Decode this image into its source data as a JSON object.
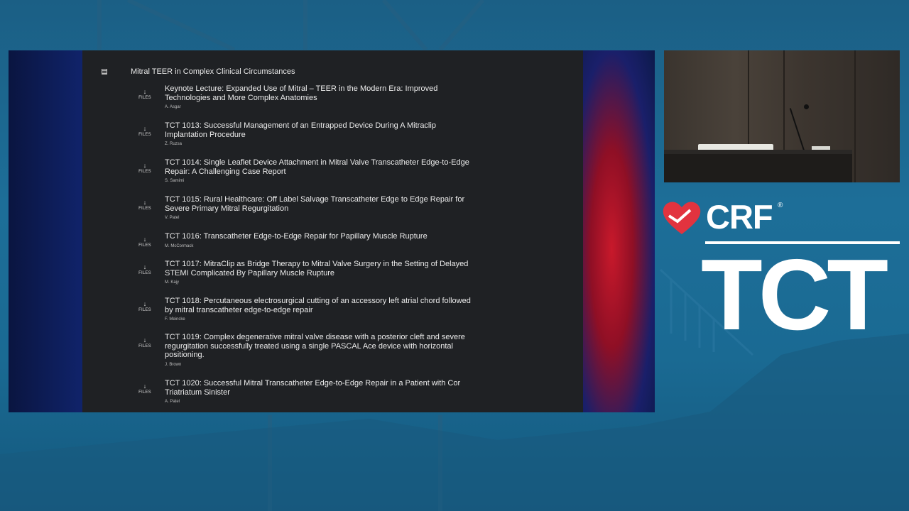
{
  "section": {
    "title": "Mitral TEER in Complex Clinical Circumstances"
  },
  "files_label": "FILES",
  "items": [
    {
      "title": "Keynote Lecture: Expanded Use of Mitral – TEER in the Modern Era: Improved Technologies and More Complex Anatomies",
      "author": "A. Asgar"
    },
    {
      "title": "TCT 1013: Successful Management of an Entrapped Device During A Mitraclip Implantation Procedure",
      "author": "Z. Ruzsa"
    },
    {
      "title": "TCT 1014: Single Leaflet Device Attachment in Mitral Valve Transcatheter Edge-to-Edge Repair: A Challenging Case Report",
      "author": "S. Samimi"
    },
    {
      "title": "TCT 1015: Rural Healthcare: Off Label Salvage Transcatheter Edge to Edge Repair for Severe Primary Mitral Regurgitation",
      "author": "V. Patel"
    },
    {
      "title": "TCT 1016: Transcatheter Edge-to-Edge Repair for Papillary Muscle Rupture",
      "author": "M. McCormack"
    },
    {
      "title": "TCT 1017: MitraClip as Bridge Therapy to Mitral Valve Surgery in the Setting of Delayed STEMI Complicated By Papillary Muscle Rupture",
      "author": "M. Kajy"
    },
    {
      "title": "TCT 1018: Percutaneous electrosurgical cutting of an accessory left atrial chord followed by  mitral transcatheter edge-to-edge repair",
      "author": "F. Meincke"
    },
    {
      "title": "TCT 1019: Complex degenerative mitral valve disease with a posterior cleft and severe regurgitation successfully treated using a single PASCAL Ace device with horizontal positioning.",
      "author": "J. Brown"
    },
    {
      "title": "TCT 1020: Successful Mitral Transcatheter Edge-to-Edge Repair in a Patient with Cor Triatriatum Sinister",
      "author": "A. Patel"
    }
  ],
  "logo": {
    "brand": "CRF",
    "registered": "®",
    "event": "TCT"
  },
  "colors": {
    "background": "#1b6890",
    "panel": "#1f2124",
    "heart": "#e2333f"
  }
}
